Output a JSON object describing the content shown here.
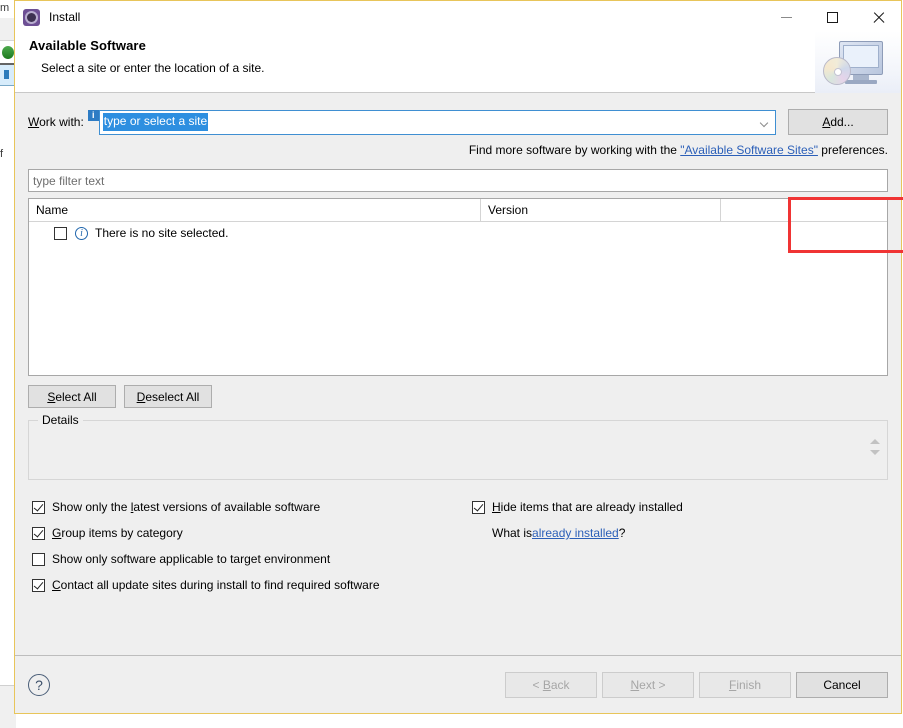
{
  "background": {
    "menu_fragment": "m",
    "lower_fragment": "f"
  },
  "window": {
    "title": "Install",
    "icon": "install-gear-icon",
    "controls": {
      "minimize": "minimize-icon",
      "maximize": "maximize-icon",
      "close": "close-icon"
    }
  },
  "header": {
    "title": "Available Software",
    "subtitle": "Select a site or enter the location of a site.",
    "art_icon": "computer-disc-icon"
  },
  "work_with": {
    "label_prefix": "W",
    "label_rest": "ork with:",
    "info_badge": "i",
    "value": "type or select a site",
    "dropdown_icon": "chevron-down-icon",
    "add_button": "Add...",
    "add_button_mnemonic": "A"
  },
  "find_more": {
    "before": "Find more software by working with the ",
    "link": "\"Available Software Sites\"",
    "after": " preferences."
  },
  "filter": {
    "placeholder": "type filter text",
    "value": ""
  },
  "table": {
    "columns": [
      "Name",
      "Version",
      ""
    ],
    "rows": [
      {
        "checked": false,
        "icon": "info-circle-icon",
        "name": "There is no site selected.",
        "version": ""
      }
    ]
  },
  "selection_buttons": {
    "select_all": "Select All",
    "deselect_all": "Deselect All"
  },
  "details": {
    "legend": "Details",
    "content": "",
    "spinner_icon": "spinner-arrows-icon"
  },
  "options": {
    "left": [
      {
        "checked": true,
        "label": "Show only the latest versions of available software"
      },
      {
        "checked": true,
        "label": "Group items by category"
      },
      {
        "checked": false,
        "label": "Show only software applicable to target environment"
      },
      {
        "checked": true,
        "label": "Contact all update sites during install to find required software"
      }
    ],
    "right": [
      {
        "checked": true,
        "label": "Hide items that are already installed"
      }
    ],
    "what_is": {
      "before": "What is ",
      "link": "already installed",
      "after": "?"
    }
  },
  "footer": {
    "help_icon": "?",
    "buttons": [
      {
        "label": "< Back",
        "enabled": false
      },
      {
        "label": "Next >",
        "enabled": false
      },
      {
        "label": "Finish",
        "enabled": false
      },
      {
        "label": "Cancel",
        "enabled": true
      }
    ]
  },
  "annotation": {
    "color": "#f03434",
    "target": "add-button"
  }
}
